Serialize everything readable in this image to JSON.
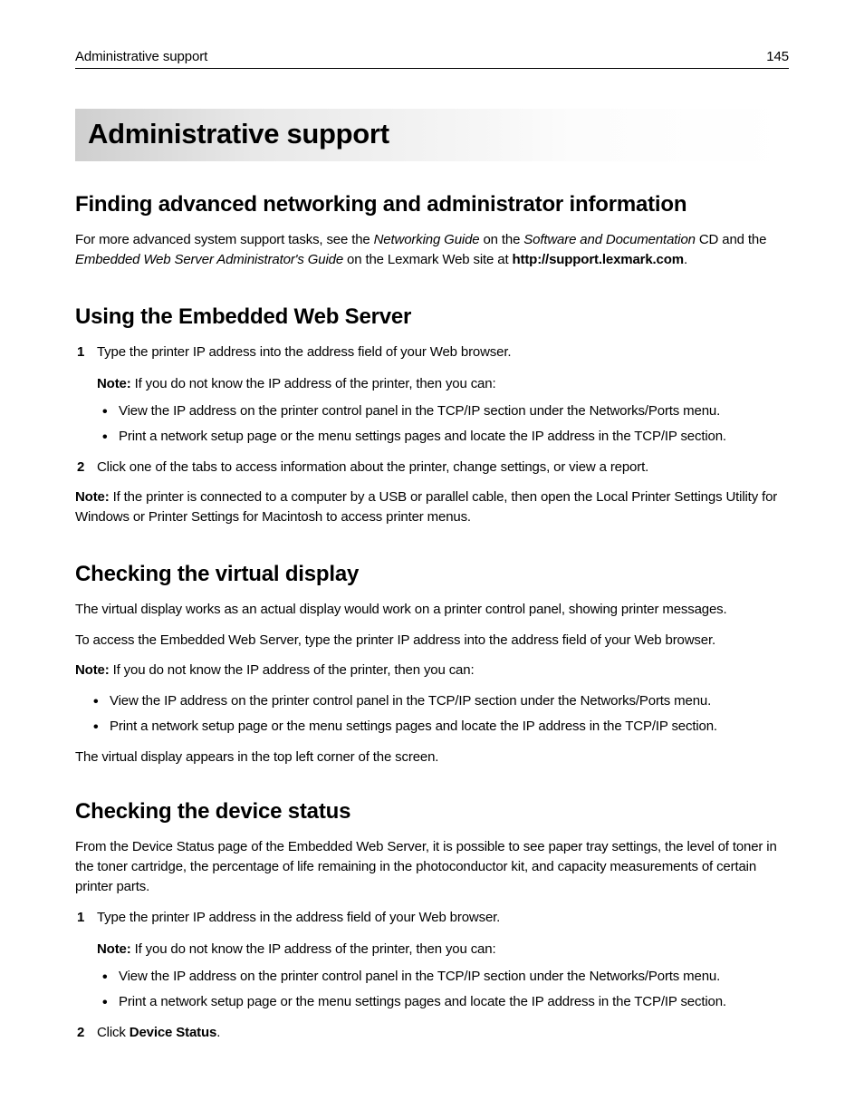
{
  "header": {
    "section_name": "Administrative support",
    "page_number": "145"
  },
  "chapter_title": "Administrative support",
  "sections": {
    "finding": {
      "heading": "Finding advanced networking and administrator information",
      "para_prefix": "For more advanced system support tasks, see the ",
      "ital1": "Networking Guide",
      "mid1": " on the ",
      "ital2": "Software and Documentation",
      "mid2": " CD and the ",
      "ital3": "Embedded Web Server Administrator's Guide",
      "mid3": " on the Lexmark Web site at ",
      "bold_url": "http://support.lexmark.com",
      "suffix": "."
    },
    "ews": {
      "heading": "Using the Embedded Web Server",
      "step1": "Type the printer IP address into the address field of your Web browser.",
      "note_label": "Note:",
      "note_text": " If you do not know the IP address of the printer, then you can:",
      "bullet1": "View the IP address on the printer control panel in the TCP/IP section under the Networks/Ports menu.",
      "bullet2": "Print a network setup page or the menu settings pages and locate the IP address in the TCP/IP section.",
      "step2": "Click one of the tabs to access information about the printer, change settings, or view a report.",
      "post_note_label": "Note:",
      "post_note_text": " If the printer is connected to a computer by a USB or parallel cable, then open the Local Printer Settings Utility for Windows or Printer Settings for Macintosh to access printer menus."
    },
    "virtual": {
      "heading": "Checking the virtual display",
      "p1": "The virtual display works as an actual display would work on a printer control panel, showing printer messages.",
      "p2": "To access the Embedded Web Server, type the printer IP address into the address field of your Web browser.",
      "note_label": "Note:",
      "note_text": " If you do not know the IP address of the printer, then you can:",
      "bullet1": "View the IP address on the printer control panel in the TCP/IP section under the Networks/Ports menu.",
      "bullet2": "Print a network setup page or the menu settings pages and locate the IP address in the TCP/IP section.",
      "p3": "The virtual display appears in the top left corner of the screen."
    },
    "device": {
      "heading": "Checking the device status",
      "p1": "From the Device Status page of the Embedded Web Server, it is possible to see paper tray settings, the level of toner in the toner cartridge, the percentage of life remaining in the photoconductor kit, and capacity measurements of certain printer parts.",
      "step1": "Type the printer IP address in the address field of your Web browser.",
      "note_label": "Note:",
      "note_text": " If you do not know the IP address of the printer, then you can:",
      "bullet1": "View the IP address on the printer control panel in the TCP/IP section under the Networks/Ports menu.",
      "bullet2": "Print a network setup page or the menu settings pages and locate the IP address in the TCP/IP section.",
      "step2_prefix": "Click ",
      "step2_bold": "Device Status",
      "step2_suffix": "."
    }
  }
}
